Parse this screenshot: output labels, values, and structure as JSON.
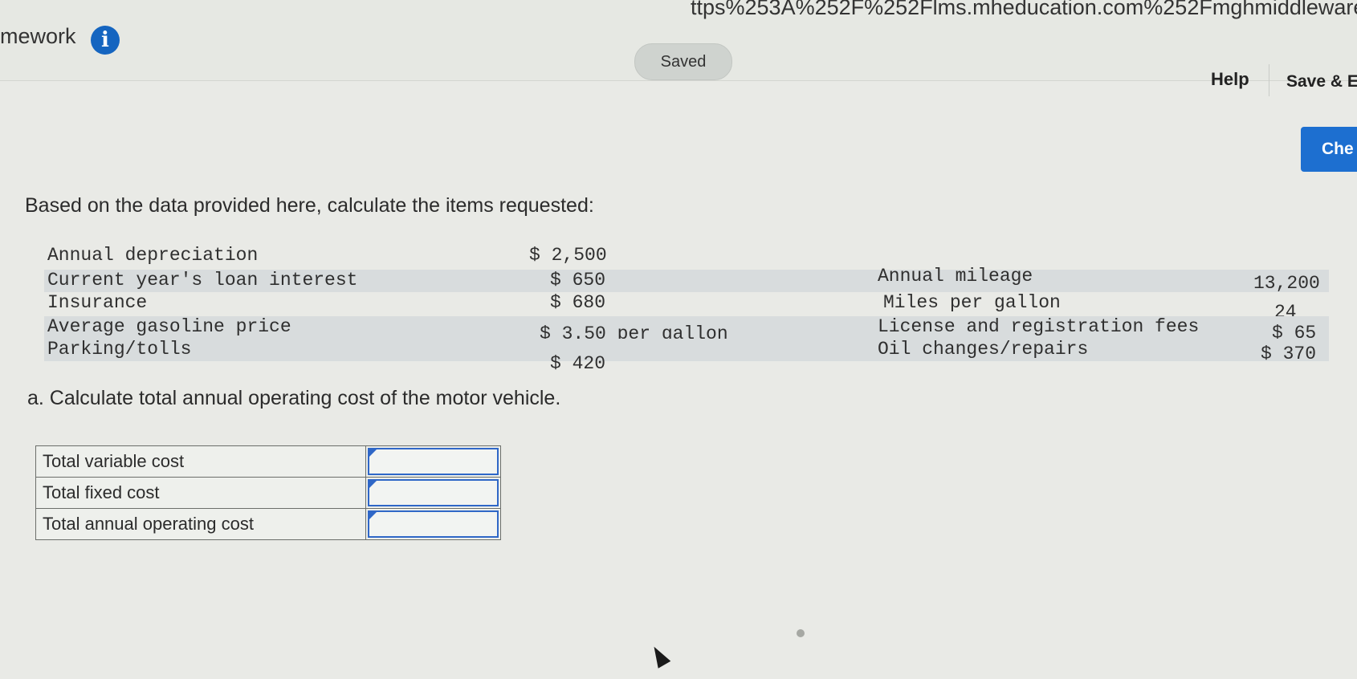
{
  "browser": {
    "url_fragment": "ttps%253A%252F%252Flms.mheducation.com%252Fmghmiddleware%252"
  },
  "header": {
    "title": "mework",
    "saved_label": "Saved",
    "help_label": "Help",
    "save_exit_label": "Save & E",
    "check_label": "Che"
  },
  "question": {
    "prompt": "Based on the data provided here, calculate the items requested:"
  },
  "data_table": {
    "left": [
      {
        "label": "Annual depreciation",
        "value": "$ 2,500"
      },
      {
        "label": "Current year's loan interest",
        "value": "$ 650"
      },
      {
        "label": "Insurance",
        "value": "$ 680"
      },
      {
        "label": "Average gasoline price",
        "value": "$ 3.50 per gallon"
      },
      {
        "label": "Parking/tolls",
        "value": "$ 420"
      }
    ],
    "right": [
      {
        "label": "Annual mileage",
        "value": "13,200"
      },
      {
        "label": "Miles per gallon",
        "value": "24"
      },
      {
        "label": "License and registration fees",
        "value": "$ 65"
      },
      {
        "label": "Oil changes/repairs",
        "value": "$ 370"
      }
    ]
  },
  "part_a": {
    "prompt": "a. Calculate total annual operating cost of the motor vehicle.",
    "rows": [
      {
        "label": "Total variable cost",
        "value": ""
      },
      {
        "label": "Total fixed cost",
        "value": ""
      },
      {
        "label": "Total annual operating cost",
        "value": ""
      }
    ]
  }
}
